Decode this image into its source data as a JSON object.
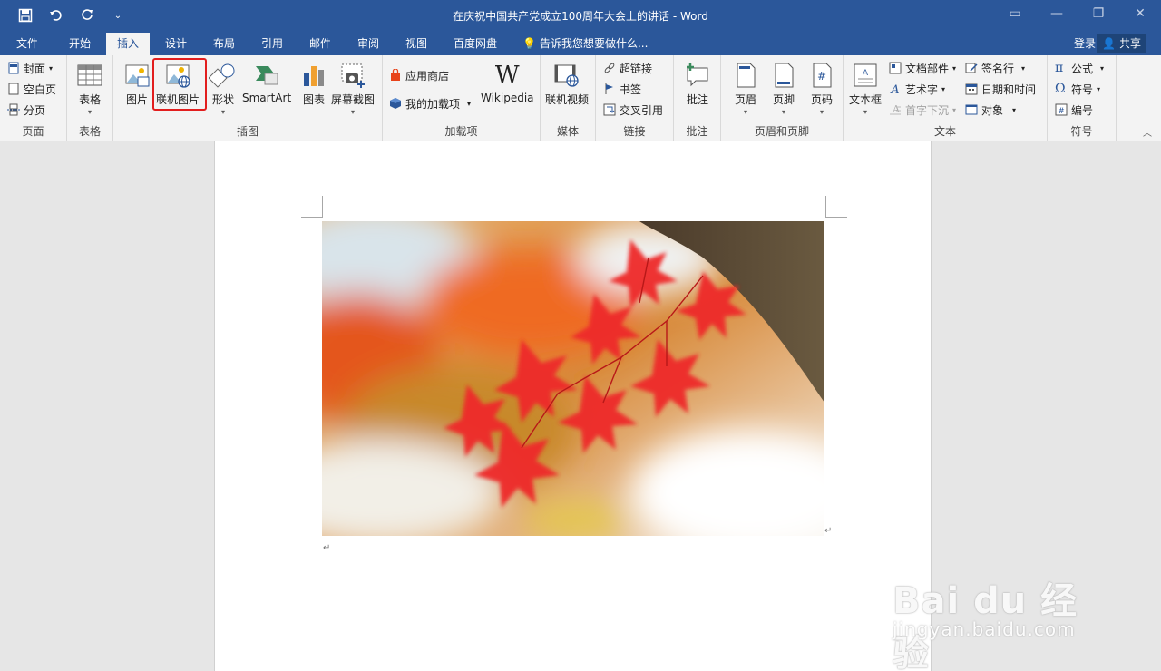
{
  "window": {
    "title": "在庆祝中国共产党成立100周年大会上的讲话 - Word",
    "controls": [
      "restore-ribbon",
      "minimize",
      "maximize",
      "close"
    ]
  },
  "tabs": [
    {
      "label": "文件",
      "active": false
    },
    {
      "label": "开始",
      "active": false
    },
    {
      "label": "插入",
      "active": true
    },
    {
      "label": "设计",
      "active": false
    },
    {
      "label": "布局",
      "active": false
    },
    {
      "label": "引用",
      "active": false
    },
    {
      "label": "邮件",
      "active": false
    },
    {
      "label": "审阅",
      "active": false
    },
    {
      "label": "视图",
      "active": false
    },
    {
      "label": "百度网盘",
      "active": false
    }
  ],
  "tellme": "告诉我您想要做什么...",
  "account": {
    "login": "登录",
    "share": "共享"
  },
  "ribbon": {
    "pages": {
      "label": "页面",
      "cover": "封面",
      "blank": "空白页",
      "break": "分页"
    },
    "tables": {
      "label": "表格",
      "table": "表格"
    },
    "illustrations": {
      "label": "插图",
      "picture": "图片",
      "online_picture": "联机图片",
      "shapes": "形状",
      "smartart": "SmartArt",
      "chart": "图表",
      "screenshot": "屏幕截图"
    },
    "addins": {
      "label": "加载项",
      "store": "应用商店",
      "my_addins": "我的加载项",
      "wikipedia": "Wikipedia"
    },
    "media": {
      "label": "媒体",
      "online_video": "联机视频"
    },
    "links": {
      "label": "链接",
      "hyperlink": "超链接",
      "bookmark": "书签",
      "crossref": "交叉引用"
    },
    "comments": {
      "label": "批注",
      "comment": "批注"
    },
    "header_footer": {
      "label": "页眉和页脚",
      "header": "页眉",
      "footer": "页脚",
      "page_number": "页码"
    },
    "text": {
      "label": "文本",
      "textbox": "文本框",
      "quickparts": "文档部件",
      "wordart": "艺术字",
      "dropcap": "首字下沉",
      "signature": "签名行",
      "datetime": "日期和时间",
      "object": "对象"
    },
    "symbols": {
      "label": "符号",
      "equation": "公式",
      "symbol": "符号",
      "number": "编号"
    }
  },
  "colors": {
    "word_blue": "#2b579a",
    "highlight_red": "#e21e1e"
  },
  "watermark": {
    "logo": "Bai du 经验",
    "url": "jingyan.baidu.com"
  }
}
